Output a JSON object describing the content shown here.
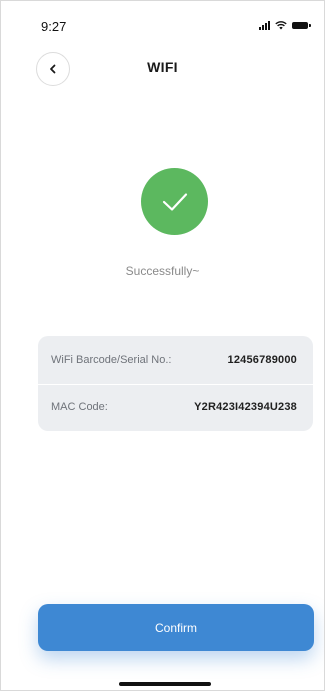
{
  "status_bar": {
    "time": "9:27",
    "icons": [
      "signal-icon",
      "wifi-icon",
      "battery-icon"
    ]
  },
  "header": {
    "title": "WIFI",
    "back_icon": "chevron-left-icon"
  },
  "success": {
    "icon": "checkmark-icon",
    "message": "Successfully~",
    "color": "#5cb85f"
  },
  "info": {
    "rows": [
      {
        "label": "WiFi Barcode/Serial No.:",
        "value": "12456789000"
      },
      {
        "label": "MAC Code:",
        "value": "Y2R423I42394U238"
      }
    ]
  },
  "footer": {
    "confirm_label": "Confirm",
    "accent_color": "#3e88d3"
  }
}
